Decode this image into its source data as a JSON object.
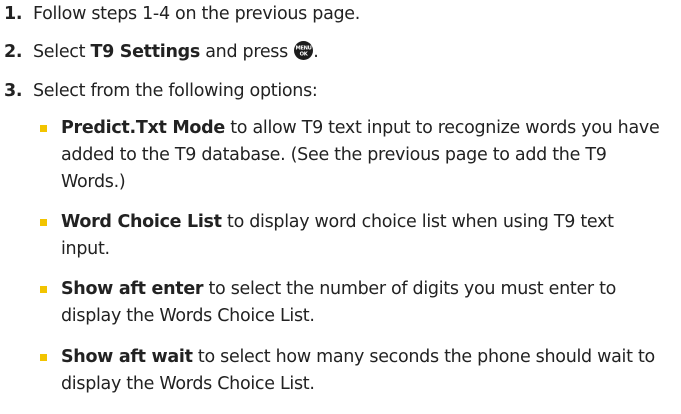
{
  "steps": [
    {
      "number": "1.",
      "text": "Follow steps 1-4 on the previous page."
    },
    {
      "number": "2.",
      "prefix": "Select ",
      "bold": "T9 Settings",
      "middle": " and press ",
      "icon": "menu-ok-icon",
      "icon_label_top": "MENU",
      "icon_label_bottom": "OK",
      "suffix": "."
    },
    {
      "number": "3.",
      "text": "Select from the following options:"
    }
  ],
  "options": [
    {
      "term": "Predict.Txt Mode",
      "description": " to allow T9 text input to recognize words you have added to the T9 database. (See the previous page to add the T9 Words.)"
    },
    {
      "term": "Word Choice List",
      "description": " to display word choice list when using T9 text input."
    },
    {
      "term": "Show aft enter",
      "description": " to select the number of digits you must enter to display the Words Choice List."
    },
    {
      "term": "Show aft wait",
      "description": " to select how many seconds the phone should wait to display the Words Choice List."
    }
  ],
  "colors": {
    "text": "#222222",
    "bullet": "#f2c400",
    "icon_background": "#1c1c1c"
  }
}
